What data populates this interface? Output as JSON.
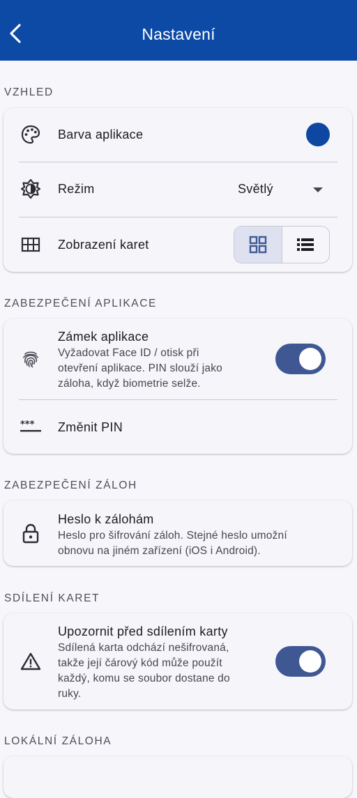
{
  "appbar": {
    "title": "Nastavení",
    "back_icon": "arrow-back-icon"
  },
  "colors": {
    "appbar": "#0c4aa6",
    "accent_dot": "#0d47a1",
    "toggle_on": "#3f5793"
  },
  "sections": {
    "appearance": {
      "header": "VZHLED",
      "app_color": {
        "label": "Barva aplikace",
        "icon": "palette-icon"
      },
      "mode": {
        "label": "Režim",
        "value": "Světlý",
        "icon": "brightness-icon"
      },
      "card_view": {
        "label": "Zobrazení karet",
        "icon": "grid-icon",
        "options": [
          "grid-view-icon",
          "list-view-icon"
        ],
        "selected": "grid-view-icon"
      }
    },
    "app_security": {
      "header": "ZABEZPEČENÍ APLIKACE",
      "app_lock": {
        "label": "Zámek aplikace",
        "line1": "Vyžadovat Face ID / otisk při",
        "line2": "otevření aplikace. PIN slouží jako",
        "line3": "záloha, když biometrie selže.",
        "enabled": true,
        "icon": "fingerprint-icon"
      },
      "change_pin": {
        "label": "Změnit PIN",
        "icon": "password-icon"
      }
    },
    "backup_security": {
      "header": "ZABEZPEČENÍ ZÁLOH",
      "backup_password": {
        "label": "Heslo k zálohám",
        "line1": "Heslo pro šifrování záloh. Stejné heslo umožní",
        "line2": "obnovu na jiném zařízení (iOS i Android).",
        "icon": "lock-icon"
      }
    },
    "card_sharing": {
      "header": "SDÍLENÍ KARET",
      "warn_share": {
        "label": "Upozornit před sdílením karty",
        "line1": "Sdílená karta odchází nešifrovaná,",
        "line2": "takže její čárový kód může použít",
        "line3": "každý, komu se soubor dostane do",
        "line4": "ruky.",
        "enabled": true,
        "icon": "warning-icon"
      }
    },
    "local_backup": {
      "header": "LOKÁLNÍ ZÁLOHA"
    }
  }
}
